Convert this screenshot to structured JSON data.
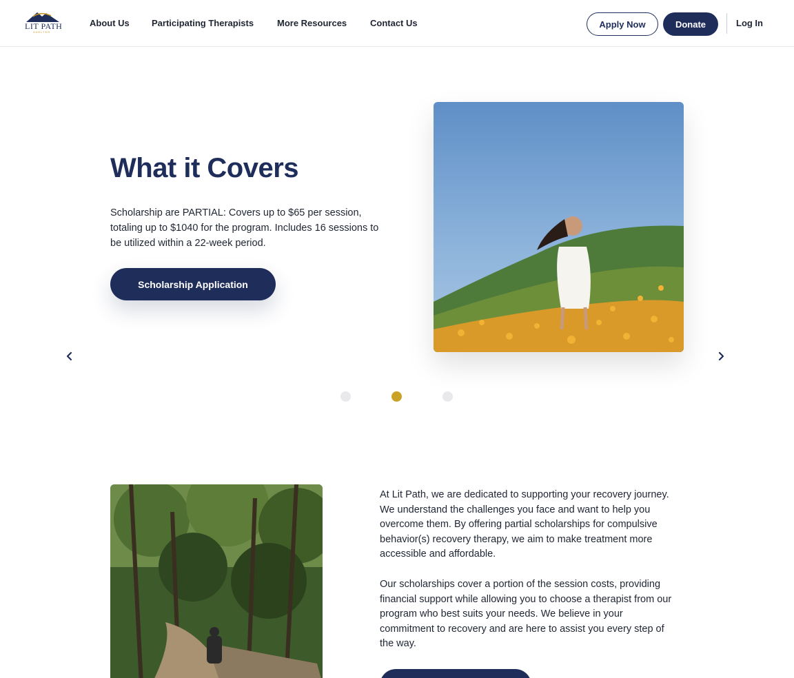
{
  "header": {
    "logo": {
      "name": "LIT PATH",
      "tagline": "SHELTER"
    },
    "nav": [
      {
        "label": "About Us"
      },
      {
        "label": "Participating Therapists"
      },
      {
        "label": "More Resources"
      },
      {
        "label": "Contact Us"
      }
    ],
    "apply_label": "Apply Now",
    "donate_label": "Donate",
    "login_label": "Log In"
  },
  "carousel": {
    "title": "What it Covers",
    "text": "Scholarship are PARTIAL: Covers up to $65 per session, totaling up to $1040 for the program. Includes 16 sessions to be utilized within a 22-week period.",
    "button_label": "Scholarship Application",
    "active_dot": 1,
    "dots_count": 3
  },
  "about": {
    "paragraph_1": "At Lit Path, we are dedicated to supporting your recovery journey. We understand the challenges you face and want to help you overcome them. By offering partial scholarships for compulsive behavior(s) recovery therapy, we aim to make treatment more accessible and affordable.",
    "paragraph_2": "Our scholarships cover a portion of the session costs, providing financial support while allowing you to choose a therapist from our program who best suits your needs. We believe in your commitment to recovery and are here to assist you every step of the way."
  },
  "colors": {
    "brand_navy": "#1e2d5a",
    "accent_gold": "#c9a227",
    "dot_inactive": "#e9e9ec"
  },
  "icons": {
    "prev": "chevron-left-icon",
    "next": "chevron-right-icon"
  }
}
